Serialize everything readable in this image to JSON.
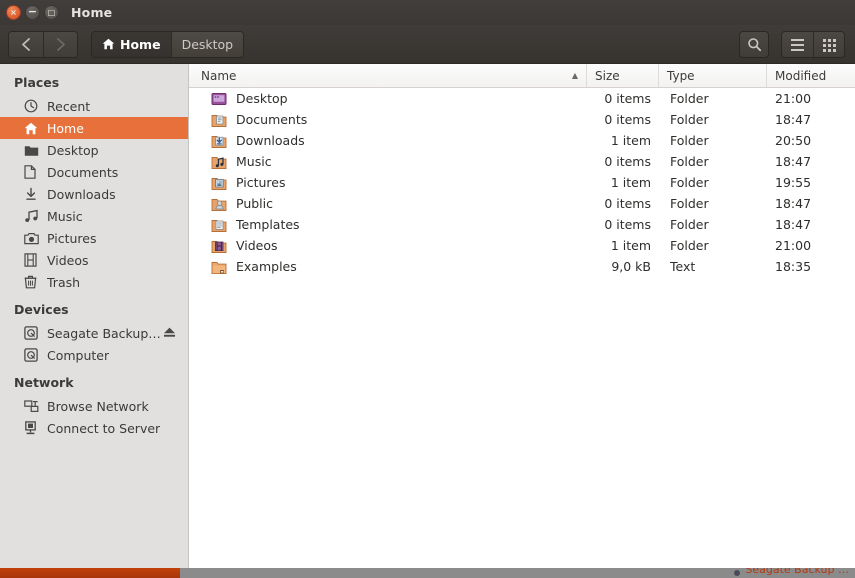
{
  "window": {
    "title": "Home",
    "controls": [
      {
        "name": "close",
        "glyph": "×"
      },
      {
        "name": "minimize",
        "glyph": "−"
      },
      {
        "name": "maximize",
        "glyph": "□"
      }
    ]
  },
  "toolbar": {
    "back_label": "Back",
    "forward_label": "Forward",
    "search_label": "Search",
    "menu_label": "Menu",
    "viewmode_label": "View options",
    "breadcrumbs": [
      {
        "label": "Home",
        "icon": "home-icon",
        "active": true
      },
      {
        "label": "Desktop",
        "icon": "",
        "active": false
      }
    ]
  },
  "sidebar": {
    "sections": [
      {
        "title": "Places",
        "items": [
          {
            "label": "Recent",
            "icon": "clock-icon",
            "selected": false,
            "eject": false
          },
          {
            "label": "Home",
            "icon": "home-icon",
            "selected": true,
            "eject": false
          },
          {
            "label": "Desktop",
            "icon": "folder-icon",
            "selected": false,
            "eject": false
          },
          {
            "label": "Documents",
            "icon": "document-icon",
            "selected": false,
            "eject": false
          },
          {
            "label": "Downloads",
            "icon": "download-icon",
            "selected": false,
            "eject": false
          },
          {
            "label": "Music",
            "icon": "music-icon",
            "selected": false,
            "eject": false
          },
          {
            "label": "Pictures",
            "icon": "camera-icon",
            "selected": false,
            "eject": false
          },
          {
            "label": "Videos",
            "icon": "film-icon",
            "selected": false,
            "eject": false
          },
          {
            "label": "Trash",
            "icon": "trash-icon",
            "selected": false,
            "eject": false
          }
        ]
      },
      {
        "title": "Devices",
        "items": [
          {
            "label": "Seagate Backup …",
            "icon": "drive-icon",
            "selected": false,
            "eject": true
          },
          {
            "label": "Computer",
            "icon": "drive-icon",
            "selected": false,
            "eject": false
          }
        ]
      },
      {
        "title": "Network",
        "items": [
          {
            "label": "Browse Network",
            "icon": "network-icon",
            "selected": false,
            "eject": false
          },
          {
            "label": "Connect to Server",
            "icon": "server-icon",
            "selected": false,
            "eject": false
          }
        ]
      }
    ]
  },
  "filelist": {
    "columns": [
      {
        "key": "name",
        "label": "Name",
        "sorted": true,
        "sort_dir": "asc"
      },
      {
        "key": "size",
        "label": "Size",
        "sorted": false,
        "sort_dir": ""
      },
      {
        "key": "type",
        "label": "Type",
        "sorted": false,
        "sort_dir": ""
      },
      {
        "key": "modified",
        "label": "Modified",
        "sorted": false,
        "sort_dir": ""
      }
    ],
    "sort_arrow_glyph": "▲",
    "rows": [
      {
        "name": "Desktop",
        "size": "0 items",
        "type": "Folder",
        "modified": "21:00",
        "icon": "desktop-folder-icon"
      },
      {
        "name": "Documents",
        "size": "0 items",
        "type": "Folder",
        "modified": "18:47",
        "icon": "documents-folder-icon"
      },
      {
        "name": "Downloads",
        "size": "1 item",
        "type": "Folder",
        "modified": "20:50",
        "icon": "downloads-folder-icon"
      },
      {
        "name": "Music",
        "size": "0 items",
        "type": "Folder",
        "modified": "18:47",
        "icon": "music-folder-icon"
      },
      {
        "name": "Pictures",
        "size": "1 item",
        "type": "Folder",
        "modified": "19:55",
        "icon": "pictures-folder-icon"
      },
      {
        "name": "Public",
        "size": "0 items",
        "type": "Folder",
        "modified": "18:47",
        "icon": "public-folder-icon"
      },
      {
        "name": "Templates",
        "size": "0 items",
        "type": "Folder",
        "modified": "18:47",
        "icon": "templates-folder-icon"
      },
      {
        "name": "Videos",
        "size": "1 item",
        "type": "Folder",
        "modified": "21:00",
        "icon": "videos-folder-icon"
      },
      {
        "name": "Examples",
        "size": "9,0 kB",
        "type": "Text",
        "modified": "18:35",
        "icon": "examples-link-icon"
      }
    ]
  },
  "taskbar": {
    "active_item_label": "",
    "right_text": "Seagate Backup …"
  },
  "colors": {
    "accent_orange": "#e8703a",
    "titlebar_dark": "#3b3836",
    "toolbar_dark": "#3a3733",
    "sidebar_bg": "#e2e0de",
    "list_bg": "#ffffff"
  }
}
